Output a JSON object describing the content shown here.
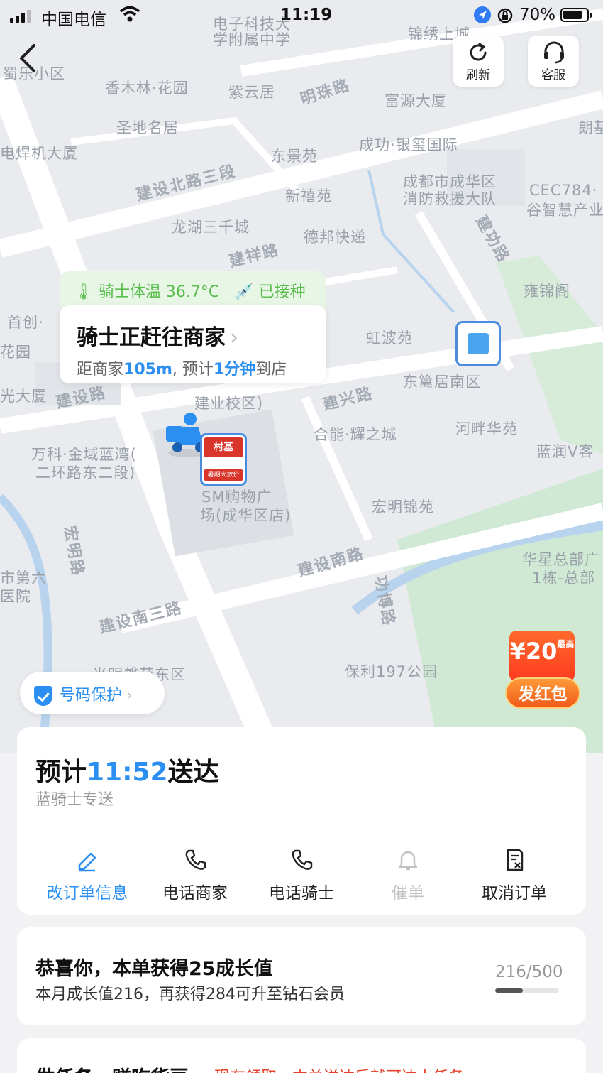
{
  "status_bar": {
    "carrier": "中国电信",
    "time": "11:19",
    "battery": "70%"
  },
  "top_buttons": {
    "refresh": "刷新",
    "support": "客服"
  },
  "map": {
    "places": [
      "电子科技大",
      "学附属中学",
      "锦绣上城",
      "蜀乐小区",
      "香木林·花园",
      "紫云居",
      "富源大厦",
      "朗基",
      "圣地名居",
      "电焊机大厦",
      "东景苑",
      "成功·银玺国际",
      "新禧苑",
      "成都市成华区",
      "消防救援大队",
      "CEC784·",
      "谷智慧产业",
      "龙湖三千城",
      "德邦快递",
      "雍锦阁",
      "首创·",
      "花园",
      "虹波苑",
      "东篱居南区",
      "光大厦",
      "建业校区)",
      "合能·耀之城",
      "河畔华苑",
      "万科·金域蓝湾(",
      "二环路东二段)",
      "蓝润V客",
      "SM购物广",
      "场(成华区店)",
      "宏明锦苑",
      "市第六",
      "医院",
      "华星总部广",
      "1栋-总部",
      "保利197公园",
      "光明馨苑东区"
    ],
    "roads": [
      "明珠路",
      "建设北路三段",
      "建祥路",
      "建功路",
      "建设路",
      "建兴路",
      "宏明路",
      "建设南路",
      "建设南三路",
      "功博路"
    ]
  },
  "rider_card": {
    "temperature": "骑士体温 36.7°C",
    "vaccinated": "已接种",
    "title": "骑士正赶往商家",
    "distance_prefix": "距商家",
    "distance": "105m",
    "eta_prefix": ", 预计",
    "eta": "1分钟",
    "eta_suffix": "到店"
  },
  "store_pin": {
    "name": "村基",
    "promo": "暑期大放价"
  },
  "phone_protect": "号码保护",
  "red_packet": {
    "amount": "¥20",
    "note": "最高",
    "button": "发红包"
  },
  "delivery": {
    "prefix": "预计",
    "time": "11:52",
    "suffix": "送达",
    "service": "蓝骑士专送",
    "actions": [
      "改订单信息",
      "电话商家",
      "电话骑士",
      "催单",
      "取消订单"
    ]
  },
  "growth": {
    "title": "恭喜你，本单获得25成长值",
    "subtitle": "本月成长值216，再获得284可升至钻石会员",
    "progress_text": "216/500",
    "progress": 0.432
  },
  "task": {
    "title": "做任务，赚吃货豆",
    "hint": "现在领取，本单送达后就可达人任务"
  },
  "colors": {
    "accent": "#2a8ff1",
    "green": "#5bbd4e",
    "red": "#e8432b"
  }
}
